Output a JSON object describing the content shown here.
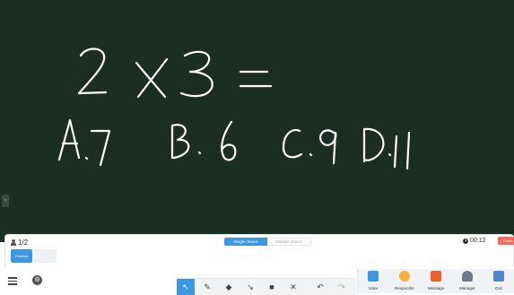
{
  "board": {
    "expression": "2 X 3 =",
    "choices": "A.7  B.6  C.9  D.11",
    "side_handle_icon": "chevron-left-icon"
  },
  "quiz": {
    "participants": "1/2",
    "tabs": [
      "Single choice",
      "Multiple choice"
    ],
    "active_tab": "Single choice",
    "timer": "00:12",
    "finish_label": "Finish",
    "option_selected": "Choices",
    "colors": {
      "accent": "#3d97e0",
      "finish": "#f26b5e",
      "board": "#1a2e24"
    }
  },
  "toolbar": {
    "tools": [
      {
        "name": "select",
        "icon": "cursor-icon"
      },
      {
        "name": "pen",
        "icon": "pen-icon"
      },
      {
        "name": "eraser",
        "icon": "eraser-icon"
      },
      {
        "name": "laser",
        "icon": "laser-icon"
      },
      {
        "name": "shape",
        "icon": "shape-icon"
      },
      {
        "name": "clear",
        "icon": "cross-icon"
      },
      {
        "name": "undo",
        "icon": "undo-icon"
      },
      {
        "name": "redo",
        "icon": "redo-icon"
      }
    ]
  },
  "side_panel": {
    "items": [
      {
        "label": "Voter",
        "icon": "voter-icon"
      },
      {
        "label": "Responder",
        "icon": "responder-icon"
      },
      {
        "label": "Message",
        "icon": "message-icon"
      },
      {
        "label": "Manager",
        "icon": "manager-icon"
      },
      {
        "label": "Exit",
        "icon": "exit-icon"
      }
    ]
  }
}
